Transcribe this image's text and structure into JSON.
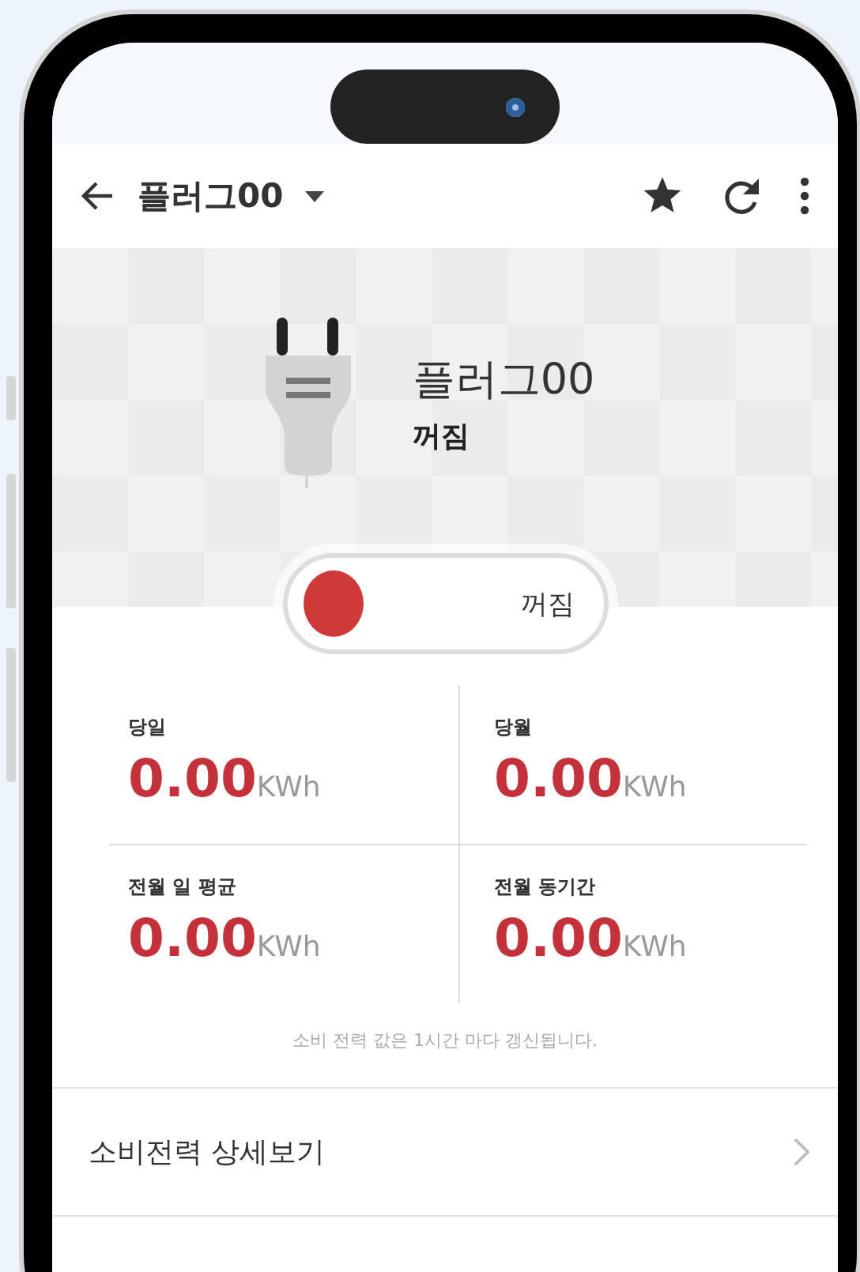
{
  "app_bar": {
    "title": "플러그00"
  },
  "device": {
    "name": "플러그00",
    "status": "꺼짐"
  },
  "power_switch": {
    "on": false,
    "label": "꺼짐"
  },
  "stats": [
    {
      "label": "당일",
      "value": "0.00",
      "unit": "KWh"
    },
    {
      "label": "당월",
      "value": "0.00",
      "unit": "KWh"
    },
    {
      "label": "전월 일 평균",
      "value": "0.00",
      "unit": "KWh"
    },
    {
      "label": "전월 동기간",
      "value": "0.00",
      "unit": "KWh"
    }
  ],
  "note": "소비 전력 값은 1시간 마다 갱신됩니다.",
  "menu": [
    {
      "label": "소비전력 상세보기"
    }
  ]
}
